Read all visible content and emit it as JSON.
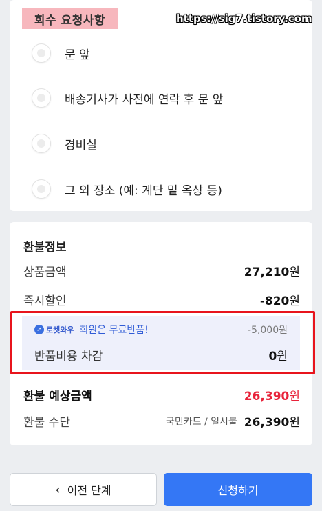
{
  "pickup": {
    "title": "회수 요청사항",
    "options": [
      {
        "label": "문 앞"
      },
      {
        "label": "배송기사가 사전에 연락 후 문 앞"
      },
      {
        "label": "경비실"
      },
      {
        "label": "그 외 장소 (예: 계단 밑 옥상 등)"
      }
    ]
  },
  "watermark": "https://sig7.tistory.com",
  "refund": {
    "title": "환불정보",
    "product_amount_label": "상품금액",
    "product_amount_value": "27,210",
    "instant_discount_label": "즉시할인",
    "instant_discount_value": "-820",
    "currency": "원",
    "promo": {
      "brand": "로켓와우",
      "message": "회원은 무료반품!",
      "original_fee": "-5,000원",
      "fee_label": "반품비용 차감",
      "fee_value": "0"
    },
    "expected_label": "환불 예상금액",
    "expected_value": "26,390",
    "method_label": "환불 수단",
    "method_card": "국민카드 / 일시불",
    "method_value": "26,390"
  },
  "buttons": {
    "prev": "이전 단계",
    "apply": "신청하기"
  },
  "colors": {
    "accent": "#3477f5",
    "highlight_red": "#e8141c",
    "expected_red": "#e8233a",
    "tag_pink": "#f7b7bd"
  }
}
